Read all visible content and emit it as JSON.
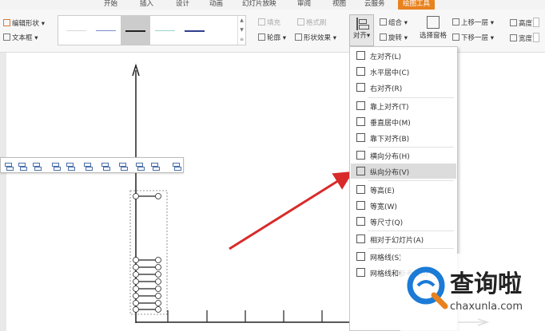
{
  "tabs": [
    {
      "label": "开始",
      "active": false
    },
    {
      "label": "插入",
      "active": false
    },
    {
      "label": "设计",
      "active": false
    },
    {
      "label": "动画",
      "active": false
    },
    {
      "label": "幻灯片放映",
      "active": false
    },
    {
      "label": "审阅",
      "active": false
    },
    {
      "label": "视图",
      "active": false
    },
    {
      "label": "云服务",
      "active": false
    },
    {
      "label": "绘图工具",
      "active": true
    }
  ],
  "ribbon": {
    "edit_shape": "编辑形状",
    "text_box": "文本框",
    "fill": "填充",
    "format_painter": "格式刷",
    "outline": "轮廓",
    "shape_effects": "形状效果",
    "align": "对齐",
    "group": "组合",
    "rotate": "旋转",
    "selection_pane": "选择窗格",
    "bring_forward": "上移一层",
    "send_backward": "下移一层",
    "height": "高度",
    "width": "宽度"
  },
  "align_menu": {
    "items": [
      {
        "label": "左对齐(L)",
        "icon": "align-left-icon"
      },
      {
        "label": "水平居中(C)",
        "icon": "align-center-icon"
      },
      {
        "label": "右对齐(R)",
        "icon": "align-right-icon"
      },
      {
        "label": "靠上对齐(T)",
        "icon": "align-top-icon"
      },
      {
        "label": "垂直居中(M)",
        "icon": "align-middle-icon"
      },
      {
        "label": "靠下对齐(B)",
        "icon": "align-bottom-icon"
      },
      {
        "label": "横向分布(H)",
        "icon": "distribute-horizontal-icon"
      },
      {
        "label": "纵向分布(V)",
        "icon": "distribute-vertical-icon"
      },
      {
        "label": "等高(E)",
        "icon": "same-height-icon"
      },
      {
        "label": "等宽(W)",
        "icon": "same-width-icon"
      },
      {
        "label": "等尺寸(Q)",
        "icon": "same-size-icon"
      },
      {
        "label": "相对于幻灯片(A)",
        "icon": "relative-to-slide-icon"
      },
      {
        "label": "网格线(S)",
        "icon": "gridlines-icon"
      },
      {
        "label": "网格线和参考线(I)",
        "icon": "grid-and-guides-icon"
      }
    ],
    "highlighted": "纵向分布(V)"
  },
  "watermark": {
    "brand": "查询啦",
    "domain": "chaxunla.com"
  },
  "colors": {
    "accent": "#e8821f",
    "arrow": "#d92a2a",
    "logo_blue": "#1b7bd6",
    "menu_highlight": "#dcdcdc"
  }
}
